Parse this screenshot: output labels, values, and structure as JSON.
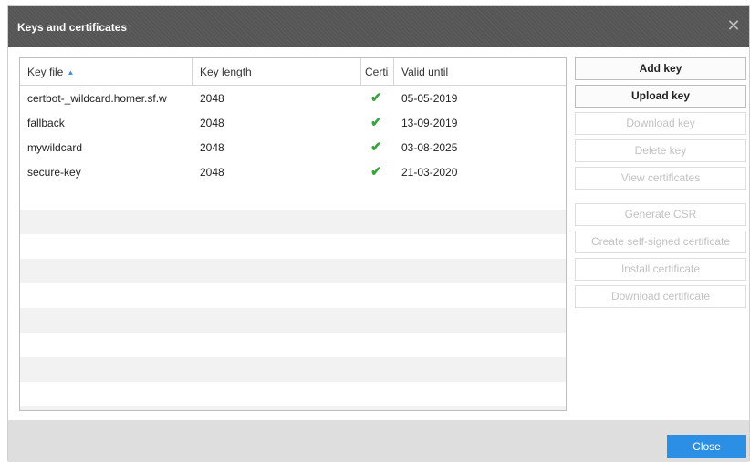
{
  "window": {
    "title": "Keys and certificates",
    "close_glyph": "✕"
  },
  "table": {
    "headers": {
      "key_file": "Key file",
      "key_length": "Key length",
      "cert": "Certi",
      "valid_until": "Valid until"
    },
    "sort_icon": "▲",
    "rows": [
      {
        "key_file": "certbot-_wildcard.homer.sf.w",
        "key_length": "2048",
        "cert": "✔",
        "valid_until": "05-05-2019"
      },
      {
        "key_file": "fallback",
        "key_length": "2048",
        "cert": "✔",
        "valid_until": "13-09-2019"
      },
      {
        "key_file": "mywildcard",
        "key_length": "2048",
        "cert": "✔",
        "valid_until": "03-08-2025"
      },
      {
        "key_file": "secure-key",
        "key_length": "2048",
        "cert": "✔",
        "valid_until": "21-03-2020"
      }
    ]
  },
  "actions": {
    "add_key": "Add key",
    "upload_key": "Upload key",
    "download_key": "Download key",
    "delete_key": "Delete key",
    "view_certificates": "View certificates",
    "generate_csr": "Generate CSR",
    "create_self_signed": "Create self-signed certificate",
    "install_certificate": "Install certificate",
    "download_certificate": "Download certificate"
  },
  "footer": {
    "close": "Close"
  },
  "colors": {
    "accent": "#2c8fe6",
    "check": "#3aa341",
    "titlebar": "#555555"
  }
}
